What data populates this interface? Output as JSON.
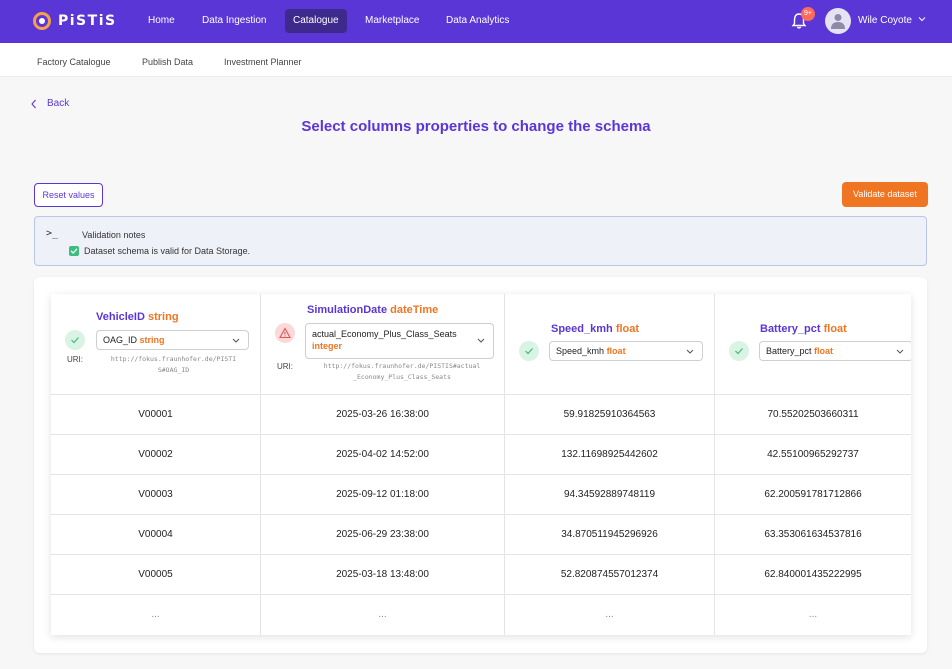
{
  "app": {
    "logo_text": "PiSTiS",
    "brand_color": "#5b36d6",
    "accent_color": "#f07522"
  },
  "nav": {
    "items": [
      {
        "label": "Home",
        "active": false
      },
      {
        "label": "Data Ingestion",
        "active": false
      },
      {
        "label": "Catalogue",
        "active": true
      },
      {
        "label": "Marketplace",
        "active": false
      },
      {
        "label": "Data Analytics",
        "active": false
      }
    ],
    "notifications": "9+",
    "user_name": "Wile Coyote"
  },
  "subnav": {
    "items": [
      "Factory Catalogue",
      "Publish Data",
      "Investment Planner"
    ]
  },
  "page": {
    "back_label": "Back",
    "title": "Select columns properties to change the schema",
    "reset_label": "Reset values",
    "validate_label": "Validate dataset"
  },
  "notes": {
    "title": "Validation notes",
    "message": "Dataset schema is valid for Data Storage."
  },
  "table": {
    "uri_label": "URI:",
    "columns": [
      {
        "name": "VehicleID",
        "type": "string",
        "status": "valid",
        "select_name": "OAG_ID",
        "select_type": "string",
        "uri": "http://fokus.fraunhofer.de/PISTIS#OAG_ID",
        "uri_line1": "http://fokus.fraunhofer.de/PISTI",
        "uri_line2": "S#OAG_ID"
      },
      {
        "name": "SimulationDate",
        "type": "dateTime",
        "status": "error",
        "select_name": "actual_Economy_Plus_Class_Seats",
        "select_type": "integer",
        "uri": "http://fokus.fraunhofer.de/PISTIS#actual_Economy_Plus_Class_Seats",
        "uri_line1": "http://fokus.fraunhofer.de/PISTIS#actual",
        "uri_line2": "_Economy_Plus_Class_Seats"
      },
      {
        "name": "Speed_kmh",
        "type": "float",
        "status": "valid",
        "select_name": "Speed_kmh",
        "select_type": "float"
      },
      {
        "name": "Battery_pct",
        "type": "float",
        "status": "valid",
        "select_name": "Battery_pct",
        "select_type": "float"
      }
    ],
    "rows": [
      [
        "V00001",
        "2025-03-26 16:38:00",
        "59.91825910364563",
        "70.55202503660311"
      ],
      [
        "V00002",
        "2025-04-02 14:52:00",
        "132.11698925442602",
        "42.55100965292737"
      ],
      [
        "V00003",
        "2025-09-12 01:18:00",
        "94.34592889748119",
        "62.200591781712866"
      ],
      [
        "V00004",
        "2025-06-29 23:38:00",
        "34.870511945296926",
        "63.353061634537816"
      ],
      [
        "V00005",
        "2025-03-18 13:48:00",
        "52.820874557012374",
        "62.840001435222995"
      ],
      [
        "...",
        "...",
        "...",
        "..."
      ]
    ]
  }
}
